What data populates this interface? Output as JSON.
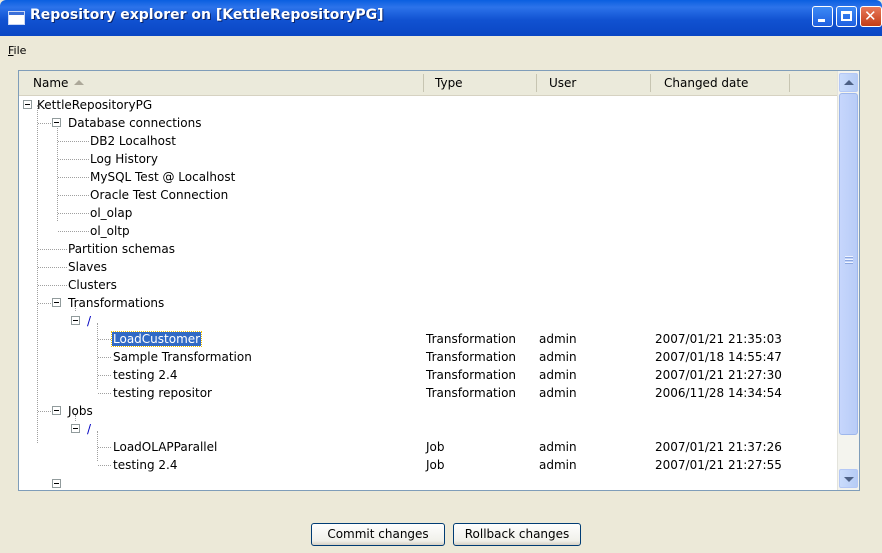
{
  "window": {
    "title": "Repository explorer on [KettleRepositoryPG]"
  },
  "menu": {
    "file_label": "File",
    "file_label_mnemonic": "F",
    "file_label_rest": "ile"
  },
  "columns": {
    "name": "Name",
    "type": "Type",
    "user": "User",
    "changed_date": "Changed date"
  },
  "tree": {
    "root": "KettleRepositoryPG",
    "database_connections": {
      "label": "Database connections",
      "items": [
        "DB2 Localhost",
        "Log History",
        "MySQL Test @ Localhost",
        "Oracle Test Connection",
        "ol_olap",
        "ol_oltp"
      ]
    },
    "partition_schemas": "Partition schemas",
    "slaves": "Slaves",
    "clusters": "Clusters",
    "transformations": {
      "label": "Transformations",
      "folder": "/",
      "items": [
        {
          "name": "LoadCustomer",
          "type": "Transformation",
          "user": "admin",
          "date": "2007/01/21 21:35:03",
          "selected": true
        },
        {
          "name": "Sample Transformation",
          "type": "Transformation",
          "user": "admin",
          "date": "2007/01/18 14:55:47"
        },
        {
          "name": "testing 2.4",
          "type": "Transformation",
          "user": "admin",
          "date": "2007/01/21 21:27:30"
        },
        {
          "name": "testing repositor",
          "type": "Transformation",
          "user": "admin",
          "date": "2006/11/28 14:34:54"
        }
      ]
    },
    "jobs": {
      "label": "Jobs",
      "folder": "/",
      "items": [
        {
          "name": "LoadOLAPParallel",
          "type": "Job",
          "user": "admin",
          "date": "2007/01/21 21:37:26"
        },
        {
          "name": "testing 2.4",
          "type": "Job",
          "user": "admin",
          "date": "2007/01/21 21:27:55"
        }
      ]
    }
  },
  "buttons": {
    "commit": "Commit changes",
    "rollback": "Rollback changes"
  }
}
